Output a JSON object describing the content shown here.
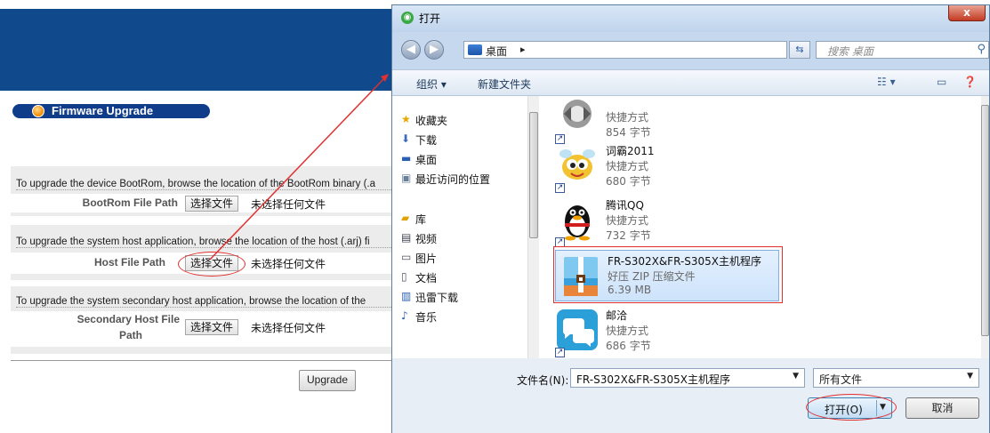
{
  "page": {
    "section_title": "Firmware Upgrade",
    "bootrom": {
      "description": "To upgrade the device BootRom, browse the location of the BootRom binary (.a",
      "label": "BootRom File Path",
      "choose_button": "选择文件",
      "no_file": "未选择任何文件"
    },
    "host": {
      "description": "To upgrade the system host application, browse the location of the host (.arj) fi",
      "label": "Host File Path",
      "choose_button": "选择文件",
      "no_file": "未选择任何文件"
    },
    "secondary": {
      "description": "To upgrade the system secondary host application, browse the location of the",
      "label_line1": "Secondary Host File",
      "label_line2": "Path",
      "choose_button": "选择文件",
      "no_file": "未选择任何文件"
    },
    "upgrade_button": "Upgrade"
  },
  "dialog": {
    "title": "打开",
    "close_glyph": "x",
    "address": {
      "location": "桌面",
      "separator": "▸"
    },
    "search_placeholder": "搜索 桌面",
    "commands": {
      "organize": "组织 ▾",
      "new_folder": "新建文件夹"
    },
    "nav": {
      "favorites": "收藏夹",
      "downloads": "下载",
      "desktop": "桌面",
      "recent": "最近访问的位置",
      "libraries": "库",
      "videos": "视频",
      "pictures": "图片",
      "documents": "文档",
      "thunder": "迅雷下载",
      "music": "音乐"
    },
    "files": [
      {
        "name": "",
        "type": "快捷方式",
        "size": "854 字节"
      },
      {
        "name": "词霸2011",
        "type": "快捷方式",
        "size": "680 字节"
      },
      {
        "name": "腾讯QQ",
        "type": "快捷方式",
        "size": "732 字节"
      },
      {
        "name": "FR-S302X&FR-S305X主机程序",
        "type": "好压 ZIP 压缩文件",
        "size": "6.39 MB"
      },
      {
        "name": "邮洽",
        "type": "快捷方式",
        "size": "686 字节"
      }
    ],
    "filename_label": "文件名(N):",
    "filename_value": "FR-S302X&FR-S305X主机程序",
    "filetype_value": "所有文件",
    "open_button": "打开(O)",
    "cancel_button": "取消"
  },
  "colors": {
    "banner": "#10498c",
    "annotation": "#e03030",
    "selection": "#cde3fb"
  }
}
